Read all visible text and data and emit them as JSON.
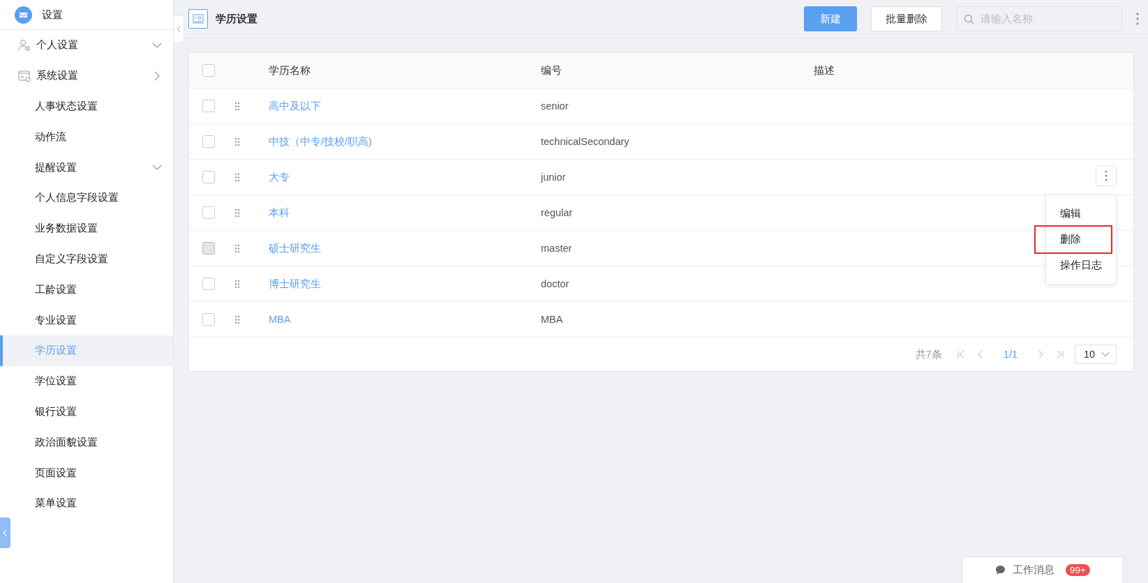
{
  "sidebar": {
    "title": "设置",
    "items": [
      {
        "label": "个人设置",
        "expanded": true,
        "selected": false
      },
      {
        "label": "系统设置",
        "expanded": false,
        "selected": false,
        "children": [
          {
            "label": "人事状态设置",
            "selected": false
          },
          {
            "label": "动作流",
            "selected": false
          },
          {
            "label": "提醒设置",
            "expanded": true,
            "selected": false
          },
          {
            "label": "个人信息字段设置",
            "selected": false
          },
          {
            "label": "业务数据设置",
            "selected": false
          },
          {
            "label": "自定义字段设置",
            "selected": false
          },
          {
            "label": "工龄设置",
            "selected": false
          },
          {
            "label": "专业设置",
            "selected": false
          },
          {
            "label": "学历设置",
            "selected": true
          },
          {
            "label": "学位设置",
            "selected": false
          },
          {
            "label": "银行设置",
            "selected": false
          },
          {
            "label": "政治面貌设置",
            "selected": false
          },
          {
            "label": "页面设置",
            "selected": false
          },
          {
            "label": "菜单设置",
            "selected": false
          }
        ]
      }
    ]
  },
  "header": {
    "title": "学历设置",
    "buttons": [
      {
        "label": "新建",
        "kind": "primary"
      },
      {
        "label": "批量删除",
        "kind": "default"
      }
    ],
    "search": {
      "placeholder": "请输入名称"
    }
  },
  "table": {
    "columns": [
      "学历名称",
      "编号",
      "描述"
    ],
    "header_checked": false,
    "rows": [
      {
        "name": "高中及以下",
        "code": "senior",
        "checked": false,
        "hover": false,
        "menu_open": false
      },
      {
        "name": "中技（中专/技校/职高)",
        "code": "technicalSecondary",
        "checked": false,
        "hover": false,
        "menu_open": false
      },
      {
        "name": "大专",
        "code": "junior",
        "checked": false,
        "hover": false,
        "menu_open": true
      },
      {
        "name": "本科",
        "code": "regular",
        "checked": false,
        "hover": false,
        "menu_open": false
      },
      {
        "name": "硕士研究生",
        "code": "master",
        "checked": false,
        "hover": true,
        "menu_open": false
      },
      {
        "name": "博士研究生",
        "code": "doctor",
        "checked": false,
        "hover": false,
        "menu_open": false
      },
      {
        "name": "MBA",
        "code": "MBA",
        "checked": false,
        "hover": false,
        "menu_open": false
      }
    ],
    "menu": [
      {
        "label": "编辑",
        "outlined": false
      },
      {
        "label": "删除",
        "outlined": true
      },
      {
        "label": "操作日志",
        "outlined": false
      }
    ],
    "pagination": {
      "total": "共7条",
      "page": "1/1",
      "page_size": "10"
    }
  },
  "messages": {
    "label": "工作消息",
    "badge": "99+"
  }
}
